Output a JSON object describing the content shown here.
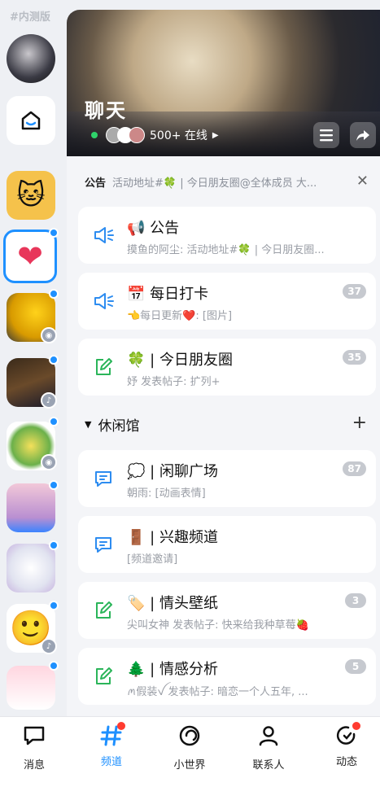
{
  "beta_label": "#内测版",
  "channel": {
    "title": "聊天",
    "online_count": "500+ 在线"
  },
  "notice": {
    "label": "公告",
    "text": "活动地址#🍀 | 今日朋友圈@全体成员 大..."
  },
  "cards": [
    {
      "emoji": "📢",
      "title": "公告",
      "subtitle": "摸鱼的阿尘: 活动地址#🍀 | 今日朋友圈...",
      "badge": "",
      "icon": "speaker-icon"
    },
    {
      "emoji": "📅",
      "title": "每日打卡",
      "subtitle": "👈每日更新❤️: [图片]",
      "badge": "37",
      "icon": "speaker-icon"
    },
    {
      "emoji": "🍀",
      "title": "| 今日朋友圈",
      "subtitle": "妤 发表帖子: 扩列+",
      "badge": "35",
      "icon": "edit-icon"
    }
  ],
  "section": {
    "name": "休闲馆"
  },
  "section_cards": [
    {
      "emoji": "💭",
      "title": "| 闲聊广场",
      "subtitle": "朝雨: [动画表情]",
      "badge": "87",
      "icon": "chat-icon"
    },
    {
      "emoji": "🚪",
      "title": "| 兴趣频道",
      "subtitle": "[频道邀请]",
      "badge": "",
      "icon": "chat-icon"
    },
    {
      "emoji": "🏷️",
      "title": "| 情头壁纸",
      "subtitle": "尖叫女神 发表帖子: 快来给我种草莓🍓",
      "badge": "3",
      "icon": "edit-icon"
    },
    {
      "emoji": "🌲",
      "title": "| 情感分析",
      "subtitle": "ꪔ假装ꪜ 发表帖子: 暗恋一个人五年, ...",
      "badge": "5",
      "icon": "edit-icon"
    }
  ],
  "tabs": [
    {
      "label": "消息",
      "icon": "message-icon",
      "active": false,
      "dot": false
    },
    {
      "label": "频道",
      "icon": "channel-icon",
      "active": true,
      "dot": true
    },
    {
      "label": "小世界",
      "icon": "world-icon",
      "active": false,
      "dot": false
    },
    {
      "label": "联系人",
      "icon": "contacts-icon",
      "active": false,
      "dot": false
    },
    {
      "label": "动态",
      "icon": "feed-icon",
      "active": false,
      "dot": true
    }
  ],
  "colors": {
    "accent": "#1e90ff",
    "speaker": "#2d8cf0",
    "edit": "#2bb55a",
    "badge": "#c6c9cf",
    "alert": "#ff3b30"
  }
}
